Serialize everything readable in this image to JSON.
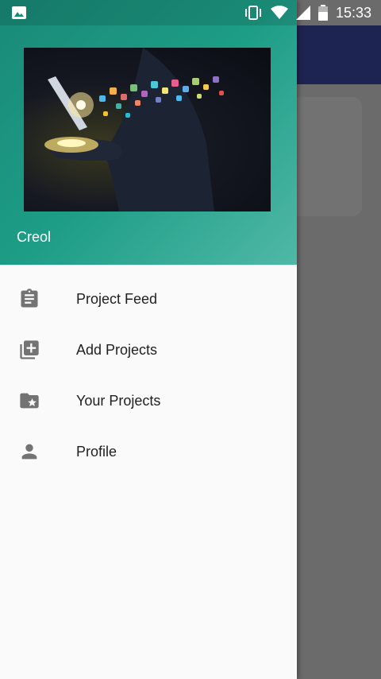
{
  "status_bar": {
    "time": "15:33",
    "icons": [
      "image-notification-icon",
      "vibrate-icon",
      "wifi-icon",
      "signal-icon",
      "battery-icon"
    ]
  },
  "drawer": {
    "header": {
      "image": "technology-hand-icon",
      "user_name": "Creol"
    },
    "items": [
      {
        "label": "Project Feed",
        "icon": "clipboard-icon"
      },
      {
        "label": "Add Projects",
        "icon": "library-add-icon"
      },
      {
        "label": "Your Projects",
        "icon": "folder-special-icon"
      },
      {
        "label": "Profile",
        "icon": "person-icon"
      }
    ]
  },
  "colors": {
    "header_gradient_start": "#1a8a78",
    "header_gradient_end": "#4fb8a6",
    "background_toolbar": "#1e2452",
    "scrim": "#6b6b6b",
    "icon_gray": "#737373"
  }
}
